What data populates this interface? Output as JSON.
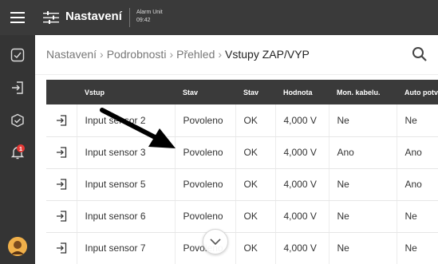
{
  "header": {
    "title": "Nastavení",
    "unit_name": "Alarm Unit",
    "time": "09:42"
  },
  "sidebar": {
    "icons": [
      "hamburger-menu-icon",
      "dashboard-check-icon",
      "login-icon",
      "check-square-icon",
      "alarm-bell-icon",
      "user-avatar-icon"
    ],
    "badge_count": "1",
    "badge_color": "#e53935"
  },
  "breadcrumb": {
    "items": [
      "Nastavení",
      "Podrobnosti",
      "Přehled"
    ],
    "current": "Vstupy ZAP/VYP",
    "separator": "›"
  },
  "table": {
    "columns": [
      "",
      "Vstup",
      "Stav",
      "Stav",
      "Hodnota",
      "Mon. kabelu.",
      "Auto potv"
    ],
    "rows": [
      {
        "name": "Input sensor 2",
        "stav": "Povoleno",
        "stav2": "OK",
        "hodnota": "4,000 V",
        "mon": "Ne",
        "auto": "Ne"
      },
      {
        "name": "Input sensor 3",
        "stav": "Povoleno",
        "stav2": "OK",
        "hodnota": "4,000 V",
        "mon": "Ano",
        "auto": "Ano"
      },
      {
        "name": "Input sensor 5",
        "stav": "Povoleno",
        "stav2": "OK",
        "hodnota": "4,000 V",
        "mon": "Ne",
        "auto": "Ano"
      },
      {
        "name": "Input sensor 6",
        "stav": "Povoleno",
        "stav2": "OK",
        "hodnota": "4,000 V",
        "mon": "Ne",
        "auto": "Ne"
      },
      {
        "name": "Input sensor 7",
        "stav": "Povoleno",
        "stav2": "OK",
        "hodnota": "4,000 V",
        "mon": "Ne",
        "auto": "Ne"
      }
    ]
  },
  "colors": {
    "dark_bar": "#3a3a3a",
    "rail": "#343434",
    "row_divider": "#e6e6e6"
  }
}
